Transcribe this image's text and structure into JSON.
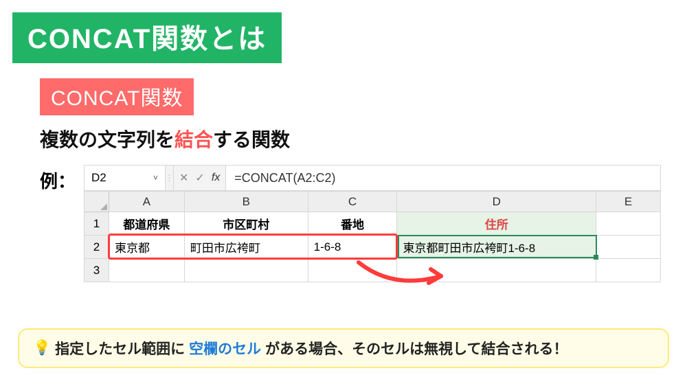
{
  "title": "CONCAT関数とは",
  "subtitle": "CONCAT関数",
  "description": {
    "part1": "複数の文字列を",
    "highlight": "結合",
    "part2": "する関数"
  },
  "example_label": "例：",
  "excel": {
    "namebox": "D2",
    "fx_label": "fx",
    "formula": "=CONCAT(A2:C2)",
    "columns": [
      "A",
      "B",
      "C",
      "D",
      "E"
    ],
    "row_numbers": [
      "1",
      "2",
      "3"
    ],
    "headers": {
      "A": "都道府県",
      "B": "市区町村",
      "C": "番地",
      "D": "住所"
    },
    "row2": {
      "A": "東京都",
      "B": "町田市広袴町",
      "C": "1-6-8",
      "D": "東京都町田市広袴町1-6-8"
    }
  },
  "tip": {
    "bulb": "💡",
    "t1": "指定したセル範囲に",
    "blue": "空欄のセル",
    "t2": "がある場合、そのセルは無視して結合される！"
  }
}
